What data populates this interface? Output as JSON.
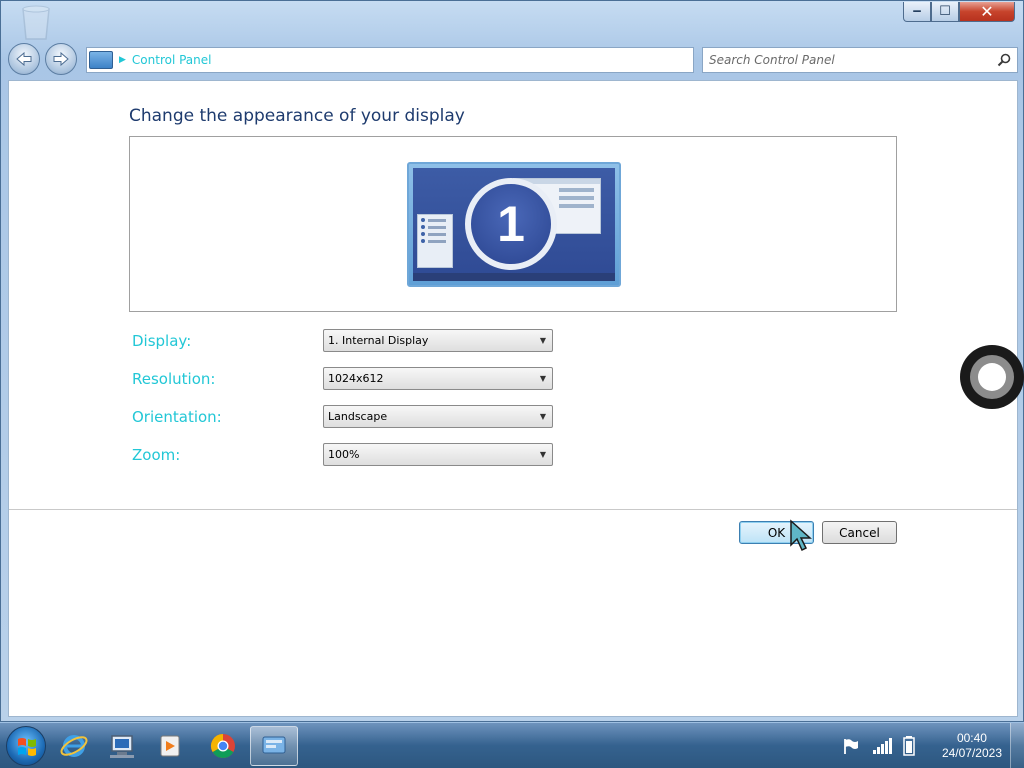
{
  "window": {
    "address": {
      "breadcrumb": "Control Panel"
    },
    "search": {
      "placeholder": "Search Control Panel"
    },
    "controls": {
      "minimize": "‒",
      "maximize": "☐",
      "close": "✕"
    }
  },
  "page": {
    "title": "Change the appearance of your display",
    "monitor_number": "1"
  },
  "settings": [
    {
      "label": "Display:",
      "value": "1. Internal Display"
    },
    {
      "label": "Resolution:",
      "value": "1024x612"
    },
    {
      "label": "Orientation:",
      "value": "Landscape"
    },
    {
      "label": "Zoom:",
      "value": "100%"
    }
  ],
  "buttons": {
    "ok": "OK",
    "cancel": "Cancel"
  },
  "taskbar": {
    "items": [
      "start",
      "internet-explorer",
      "remote-desktop",
      "media-player",
      "chrome",
      "control-panel"
    ],
    "clock": {
      "time": "00:40",
      "date": "24/07/2023"
    }
  },
  "colors": {
    "accent_text": "#22c7d6",
    "title_text": "#1e3b6e",
    "taskbar": "#35628f"
  }
}
